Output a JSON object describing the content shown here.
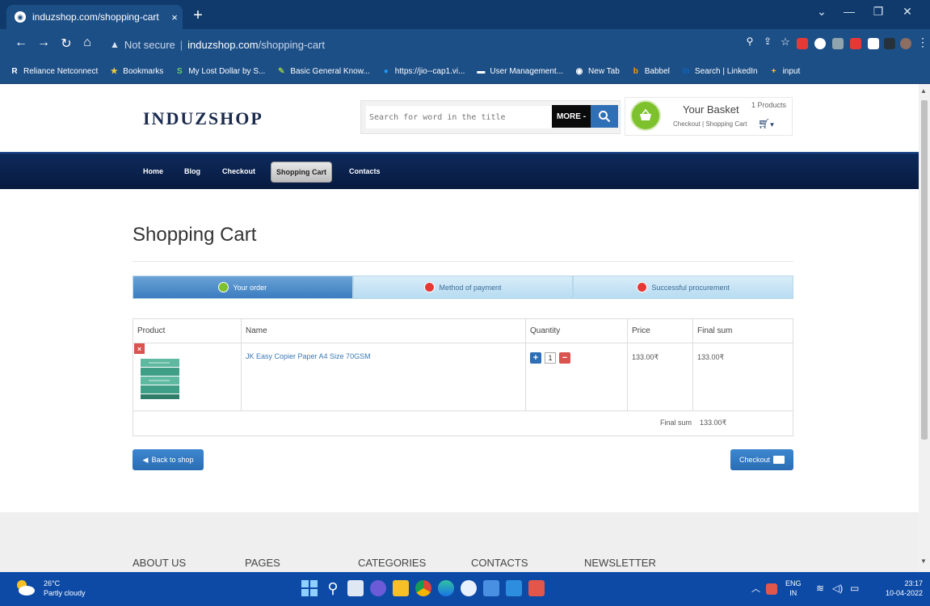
{
  "browser": {
    "tab_title": "induzshop.com/shopping-cart",
    "tab_close": "×",
    "new_tab": "+",
    "address": {
      "security": "Not secure",
      "host": "induzshop.com",
      "path": "/shopping-cart"
    },
    "bookmarks": [
      {
        "label": "Reliance Netconnect",
        "icon": "R",
        "color": "#ffffff"
      },
      {
        "label": "Bookmarks",
        "icon": "★",
        "color": "#f4d03f"
      },
      {
        "label": "My Lost Dollar by S...",
        "icon": "S",
        "color": "#66cc66"
      },
      {
        "label": "Basic General Know...",
        "icon": "✎",
        "color": "#8bc34a"
      },
      {
        "label": "https://jio--cap1.vi...",
        "icon": "●",
        "color": "#2196f3"
      },
      {
        "label": "User Management...",
        "icon": "▬",
        "color": "#ffffff"
      },
      {
        "label": "New Tab",
        "icon": "◉",
        "color": "#ffffff"
      },
      {
        "label": "Babbel",
        "icon": "b",
        "color": "#ff9800"
      },
      {
        "label": "Search | LinkedIn",
        "icon": "in",
        "color": "#0a66c2"
      },
      {
        "label": "input",
        "icon": "+",
        "color": "#ffcc00"
      }
    ]
  },
  "header": {
    "logo": "INDUZSHOP",
    "search_placeholder": "Search for word in the title",
    "more_label": "MORE -",
    "basket_title": "Your Basket",
    "basket_count": "1 Products",
    "basket_links": "Checkout | Shopping Cart",
    "basket_caret": "▾"
  },
  "nav": {
    "items": [
      {
        "label": "Home"
      },
      {
        "label": "Blog"
      },
      {
        "label": "Checkout"
      },
      {
        "label": "Shopping Cart"
      },
      {
        "label": "Contacts"
      }
    ]
  },
  "page": {
    "title": "Shopping Cart",
    "steps": [
      {
        "label": "Your order",
        "status": "done"
      },
      {
        "label": "Method of payment",
        "status": "pending"
      },
      {
        "label": "Successful procurement",
        "status": "pending"
      }
    ]
  },
  "cart": {
    "headers": {
      "product": "Product",
      "name": "Name",
      "quantity": "Quantity",
      "price": "Price",
      "final_sum": "Final sum"
    },
    "rows": [
      {
        "name": "JK Easy Copier Paper A4 Size 70GSM",
        "quantity": "1",
        "price": "133.00₹",
        "final": "133.00₹"
      }
    ],
    "total_label": "Final sum",
    "total_value": "133.00₹",
    "plus": "+",
    "minus": "−",
    "remove": "×"
  },
  "actions": {
    "back": "Back to shop",
    "checkout": "Checkout"
  },
  "footer": {
    "headings": [
      "ABOUT US",
      "PAGES",
      "CATEGORIES",
      "CONTACTS",
      "NEWSLETTER"
    ]
  },
  "taskbar": {
    "temp": "26°C",
    "weather": "Partly cloudy",
    "lang": "ENG",
    "region": "IN",
    "time": "23:17",
    "date": "10-04-2022"
  },
  "colors": {
    "accent": "#2f6fb5",
    "nav_dark": "#0d2a5c",
    "danger": "#d9534f",
    "success": "#7dc22d"
  }
}
